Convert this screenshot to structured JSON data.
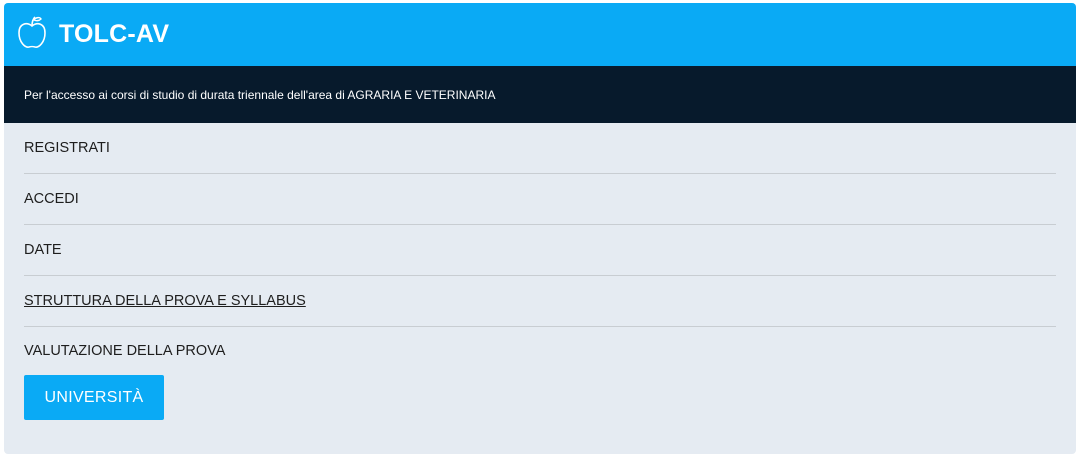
{
  "header": {
    "icon": "apple-icon",
    "title": "TOLC-AV",
    "color": "#0aaaf5"
  },
  "subbar": {
    "text": "Per l'accesso ai corsi di studio di durata triennale dell'area di AGRARIA E VETERINARIA",
    "color": "#071a2c"
  },
  "menu": {
    "items": [
      {
        "label": "REGISTRATI"
      },
      {
        "label": "ACCEDI"
      },
      {
        "label": "DATE"
      },
      {
        "label": "STRUTTURA DELLA PROVA E SYLLABUS"
      },
      {
        "label": "VALUTAZIONE DELLA PROVA"
      }
    ]
  },
  "button": {
    "label": "UNIVERSITÀ"
  }
}
